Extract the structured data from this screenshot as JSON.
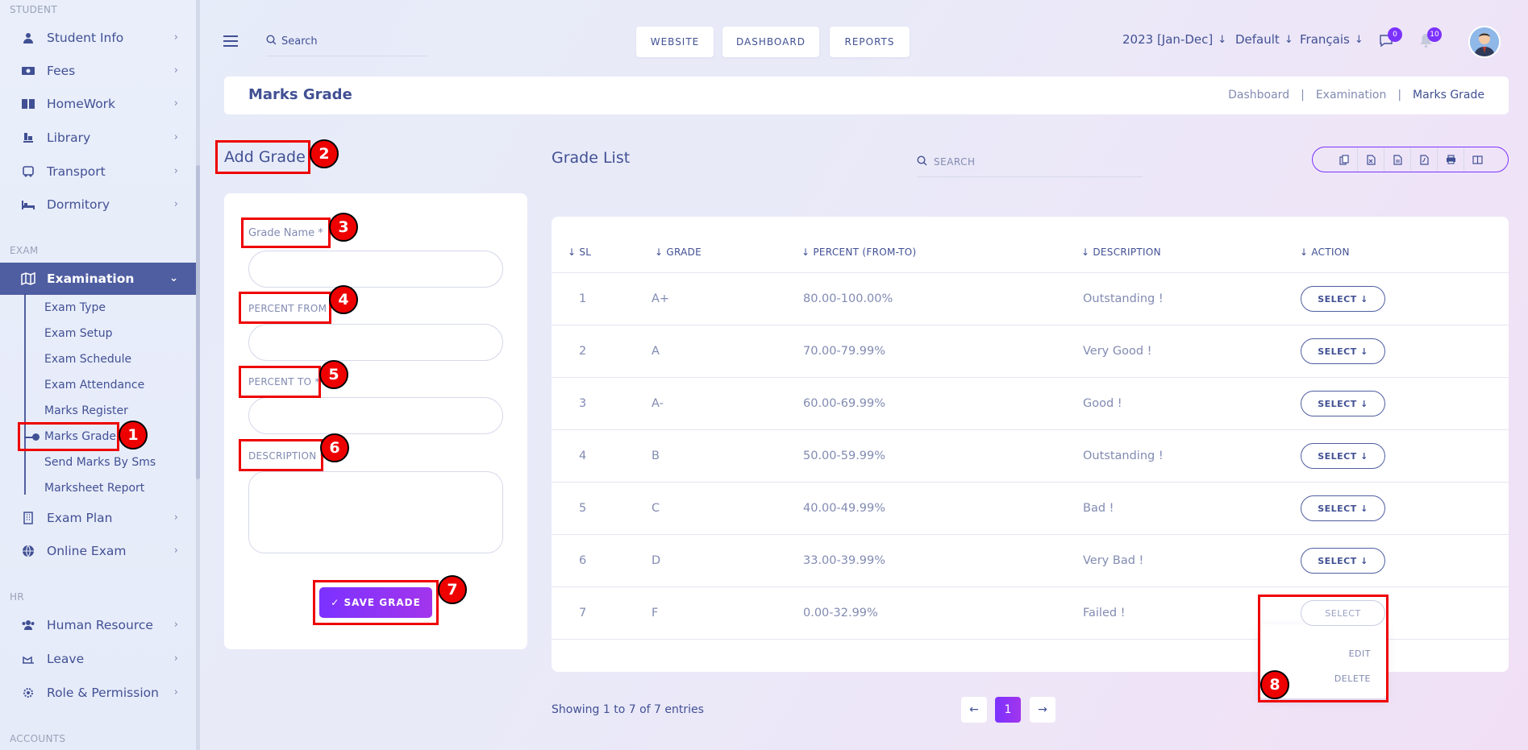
{
  "sidebar": {
    "sections": {
      "student": "STUDENT",
      "exam": "EXAM",
      "hr": "HR",
      "accounts": "ACCOUNTS"
    },
    "student_items": [
      {
        "label": "Student Info",
        "icon": "student-icon"
      },
      {
        "label": "Fees",
        "icon": "money-icon"
      },
      {
        "label": "HomeWork",
        "icon": "book-icon"
      },
      {
        "label": "Library",
        "icon": "library-icon"
      },
      {
        "label": "Transport",
        "icon": "bus-icon"
      },
      {
        "label": "Dormitory",
        "icon": "bed-icon"
      }
    ],
    "exam_items": [
      {
        "label": "Examination",
        "icon": "map-icon",
        "active": true
      },
      {
        "label": "Exam Plan",
        "icon": "building-icon"
      },
      {
        "label": "Online Exam",
        "icon": "globe-icon"
      }
    ],
    "examination_sub": [
      "Exam Type",
      "Exam Setup",
      "Exam Schedule",
      "Exam Attendance",
      "Marks Register",
      "Marks Grade",
      "Send Marks By Sms",
      "Marksheet Report"
    ],
    "hr_items": [
      {
        "label": "Human Resource",
        "icon": "users-icon"
      },
      {
        "label": "Leave",
        "icon": "leave-icon"
      },
      {
        "label": "Role & Permission",
        "icon": "gear-icon"
      }
    ]
  },
  "topbar": {
    "search_placeholder": "Search",
    "buttons": [
      "WEBSITE",
      "DASHBOARD",
      "REPORTS"
    ],
    "session": "2023 [Jan-Dec]",
    "theme": "Default",
    "language": "Français",
    "messages_count": "0",
    "notifications_count": "10"
  },
  "page": {
    "title": "Marks Grade",
    "breadcrumbs": [
      "Dashboard",
      "Examination",
      "Marks Grade"
    ]
  },
  "form": {
    "title": "Add Grade",
    "grade_name_label": "Grade Name *",
    "percent_from_label": "PERCENT FROM *",
    "percent_to_label": "PERCENT TO *",
    "description_label": "DESCRIPTION *",
    "save_label": "✓ SAVE GRADE"
  },
  "grade_list": {
    "title": "Grade List",
    "search_placeholder": "SEARCH",
    "columns": [
      "SL",
      "GRADE",
      "PERCENT (FROM-TO)",
      "DESCRIPTION",
      "ACTION"
    ],
    "rows": [
      {
        "sl": "1",
        "grade": "A+",
        "percent": "80.00-100.00%",
        "description": "Outstanding !"
      },
      {
        "sl": "2",
        "grade": "A",
        "percent": "70.00-79.99%",
        "description": "Very Good !"
      },
      {
        "sl": "3",
        "grade": "A-",
        "percent": "60.00-69.99%",
        "description": "Good !"
      },
      {
        "sl": "4",
        "grade": "B",
        "percent": "50.00-59.99%",
        "description": "Outstanding !"
      },
      {
        "sl": "5",
        "grade": "C",
        "percent": "40.00-49.99%",
        "description": "Bad !"
      },
      {
        "sl": "6",
        "grade": "D",
        "percent": "33.00-39.99%",
        "description": "Very Bad !"
      },
      {
        "sl": "7",
        "grade": "F",
        "percent": "0.00-32.99%",
        "description": "Failed !"
      }
    ],
    "select_label": "SELECT ↓",
    "select_label_plain": "SELECT",
    "dropdown": {
      "edit": "EDIT",
      "delete": "DELETE"
    },
    "showing": "Showing 1 to 7 of 7 entries",
    "current_page": "1"
  },
  "annotations": [
    "1",
    "2",
    "3",
    "4",
    "5",
    "6",
    "7",
    "8"
  ],
  "colors": {
    "primary": "#415094",
    "accent": "#7c32ff",
    "annotation": "#ee0000"
  }
}
